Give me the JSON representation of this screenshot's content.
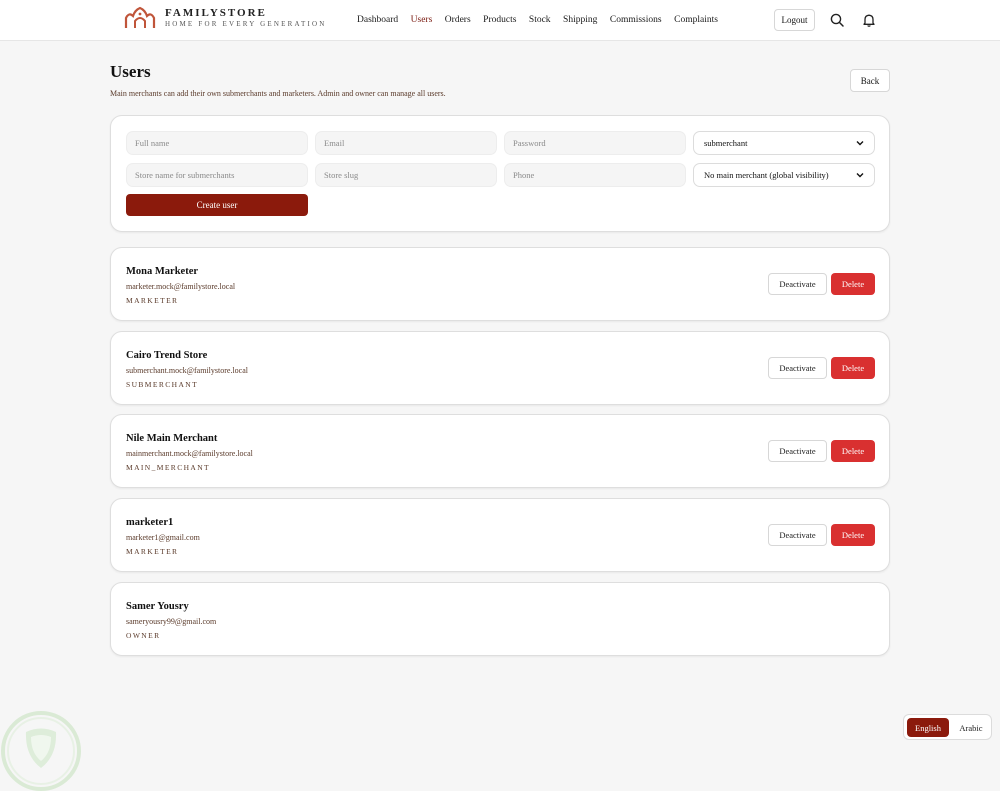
{
  "header": {
    "brand_name": "FAMILYSTORE",
    "brand_tagline": "HOME FOR EVERY GENERATION",
    "nav": [
      {
        "label": "Dashboard"
      },
      {
        "label": "Users"
      },
      {
        "label": "Orders"
      },
      {
        "label": "Products"
      },
      {
        "label": "Stock"
      },
      {
        "label": "Shipping"
      },
      {
        "label": "Commissions"
      },
      {
        "label": "Complaints"
      }
    ],
    "active_nav": "Users",
    "logout_label": "Logout",
    "icons": [
      "search-icon",
      "bell-icon"
    ]
  },
  "page": {
    "title": "Users",
    "subtitle": "Main merchants can add their own submerchants and marketers. Admin and owner can manage all users.",
    "back_label": "Back"
  },
  "form": {
    "full_name_placeholder": "Full name",
    "email_placeholder": "Email",
    "password_placeholder": "Password",
    "role_value": "submerchant",
    "store_name_placeholder": "Store name for submerchants",
    "store_slug_placeholder": "Store slug",
    "phone_placeholder": "Phone",
    "main_merchant_value": "No main merchant (global visibility)",
    "create_label": "Create user"
  },
  "users": [
    {
      "name": "Mona Marketer",
      "email": "marketer.mock@familystore.local",
      "role": "MARKETER",
      "deactivate_label": "Deactivate",
      "delete_label": "Delete"
    },
    {
      "name": "Cairo Trend Store",
      "email": "submerchant.mock@familystore.local",
      "role": "SUBMERCHANT",
      "deactivate_label": "Deactivate",
      "delete_label": "Delete"
    },
    {
      "name": "Nile Main Merchant",
      "email": "mainmerchant.mock@familystore.local",
      "role": "MAIN_MERCHANT",
      "deactivate_label": "Deactivate",
      "delete_label": "Delete"
    },
    {
      "name": "marketer1",
      "email": "marketer1@gmail.com",
      "role": "MARKETER",
      "deactivate_label": "Deactivate",
      "delete_label": "Delete"
    },
    {
      "name": "Samer Yousry",
      "email": "sameryousry99@gmail.com",
      "role": "OWNER"
    }
  ],
  "language": {
    "english": "English",
    "arabic": "Arabic",
    "active": "English"
  },
  "colors": {
    "brand": "#8b1a0c",
    "danger": "#d93030",
    "background": "#f6f6f6"
  }
}
